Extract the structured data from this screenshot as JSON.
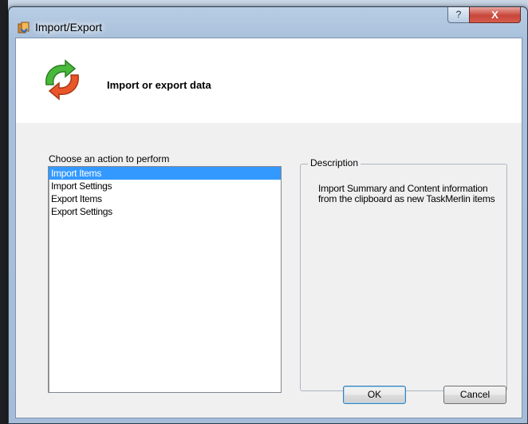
{
  "window": {
    "title": "Import/Export",
    "help_label": "?",
    "close_label": "X"
  },
  "header": {
    "title": "Import or export data"
  },
  "actions": {
    "label": "Choose an action to perform",
    "items": [
      {
        "label": "Import Items",
        "selected": true
      },
      {
        "label": "Import Settings",
        "selected": false
      },
      {
        "label": "Export Items",
        "selected": false
      },
      {
        "label": "Export Settings",
        "selected": false
      }
    ]
  },
  "description": {
    "label": "Description",
    "text": "Import Summary and Content information from the clipboard as new TaskMerlin items"
  },
  "buttons": {
    "ok": "OK",
    "cancel": "Cancel"
  },
  "colors": {
    "selection": "#3399ff",
    "close_button": "#c7463a"
  },
  "icons": {
    "app": "import-export-icon",
    "header": "sync-arrows-icon"
  }
}
